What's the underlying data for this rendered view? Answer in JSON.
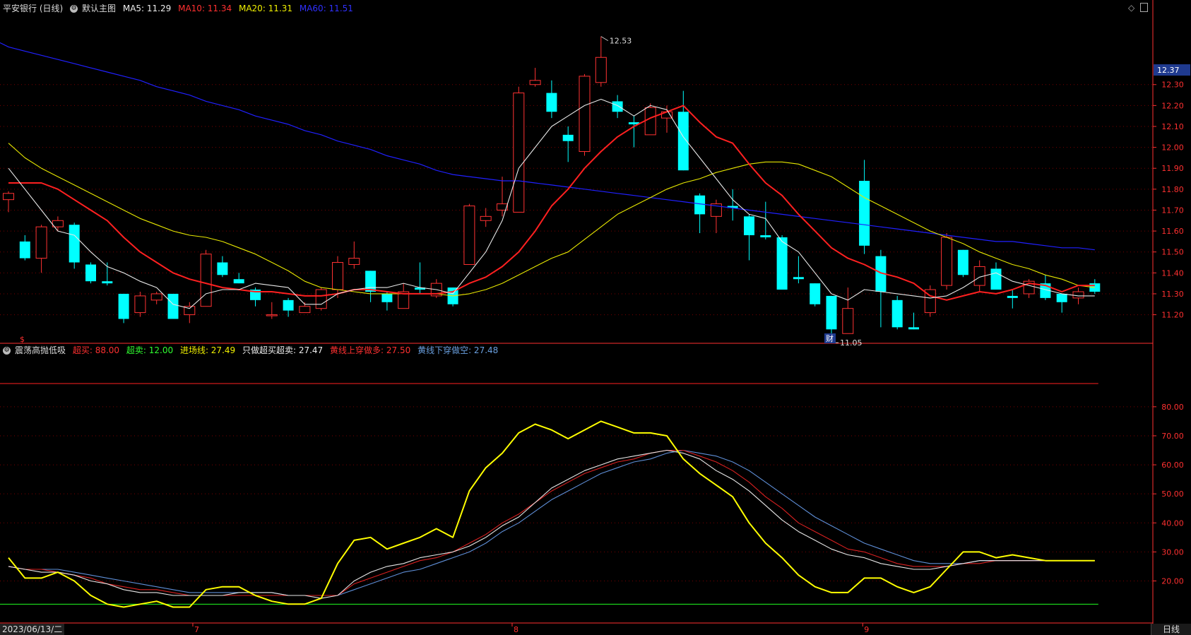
{
  "main_legend": {
    "title": "平安银行 (日线)",
    "template": "默认主图",
    "ma5": "MA5: 11.29",
    "ma10": "MA10: 11.34",
    "ma20": "MA20: 11.31",
    "ma60": "MA60: 11.51"
  },
  "sub_legend": {
    "title": "震荡高抛低吸",
    "overbuy": "超买: 88.00",
    "oversell": "超卖: 12.00",
    "entry": "进场线: 27.49",
    "only": "只做超买超卖: 27.47",
    "cross_up": "黄线上穿做多: 27.50",
    "cross_down": "黄线下穿做空: 27.48"
  },
  "colors": {
    "bg": "#000000",
    "up": "#ff3232",
    "down": "#00ffff",
    "ma5": "#e8e8e8",
    "ma10": "#ff2020",
    "ma20": "#e8e800",
    "ma60": "#2020ff",
    "grid": "#7a0000",
    "axis": "#ff3030",
    "entry": "#ffff00"
  },
  "price_marker": "12.37",
  "bottom_labels": {
    "date": "2023/06/13/二",
    "m7": "7",
    "m8": "8",
    "m9": "9",
    "tab": "日线"
  },
  "marks": {
    "s": "$",
    "cai": "财",
    "high": "12.53",
    "low": "11.05"
  },
  "chart_data": [
    {
      "type": "candlestick",
      "y_ticks": [
        "12.30",
        "12.20",
        "12.10",
        "12.00",
        "11.90",
        "11.80",
        "11.70",
        "11.60",
        "11.50",
        "11.40",
        "11.30",
        "11.20"
      ],
      "ylim": [
        11.05,
        12.63
      ],
      "candles": [
        [
          11.75,
          11.78,
          11.69,
          11.79
        ],
        [
          11.55,
          11.47,
          11.46,
          11.58
        ],
        [
          11.47,
          11.62,
          11.4,
          11.63
        ],
        [
          11.62,
          11.65,
          11.6,
          11.67
        ],
        [
          11.63,
          11.45,
          11.42,
          11.64
        ],
        [
          11.44,
          11.36,
          11.35,
          11.45
        ],
        [
          11.36,
          11.35,
          11.34,
          11.45
        ],
        [
          11.3,
          11.18,
          11.16,
          11.3
        ],
        [
          11.21,
          11.29,
          11.19,
          11.31
        ],
        [
          11.27,
          11.3,
          11.25,
          11.31
        ],
        [
          11.3,
          11.18,
          11.18,
          11.3
        ],
        [
          11.2,
          11.24,
          11.16,
          11.26
        ],
        [
          11.24,
          11.49,
          11.24,
          11.51
        ],
        [
          11.45,
          11.39,
          11.38,
          11.48
        ],
        [
          11.37,
          11.35,
          11.35,
          11.4
        ],
        [
          11.32,
          11.27,
          11.24,
          11.33
        ],
        [
          11.2,
          11.2,
          11.18,
          11.26
        ],
        [
          11.27,
          11.22,
          11.19,
          11.28
        ],
        [
          11.21,
          11.24,
          11.21,
          11.26
        ],
        [
          11.23,
          11.32,
          11.22,
          11.33
        ],
        [
          11.32,
          11.45,
          11.28,
          11.48
        ],
        [
          11.44,
          11.47,
          11.42,
          11.55
        ],
        [
          11.41,
          11.31,
          11.26,
          11.41
        ],
        [
          11.3,
          11.26,
          11.22,
          11.31
        ],
        [
          11.23,
          11.31,
          11.23,
          11.35
        ],
        [
          11.33,
          11.32,
          11.3,
          11.45
        ],
        [
          11.29,
          11.35,
          11.28,
          11.37
        ],
        [
          11.33,
          11.25,
          11.24,
          11.33
        ],
        [
          11.44,
          11.72,
          11.44,
          11.73
        ],
        [
          11.65,
          11.67,
          11.62,
          11.71
        ],
        [
          11.7,
          11.73,
          11.67,
          11.86
        ],
        [
          11.69,
          12.26,
          11.69,
          12.29
        ],
        [
          12.3,
          12.32,
          12.29,
          12.38
        ],
        [
          12.26,
          12.17,
          12.14,
          12.32
        ],
        [
          12.06,
          12.03,
          11.93,
          12.1
        ],
        [
          11.98,
          12.34,
          11.96,
          12.35
        ],
        [
          12.31,
          12.43,
          12.29,
          12.53
        ],
        [
          12.22,
          12.17,
          12.14,
          12.25
        ],
        [
          12.12,
          12.11,
          12.0,
          12.15
        ],
        [
          12.06,
          12.19,
          12.06,
          12.21
        ],
        [
          12.14,
          12.17,
          12.07,
          12.2
        ],
        [
          12.17,
          11.89,
          11.89,
          12.27
        ],
        [
          11.77,
          11.68,
          11.59,
          11.78
        ],
        [
          11.67,
          11.73,
          11.59,
          11.75
        ],
        [
          11.72,
          11.71,
          11.65,
          11.8
        ],
        [
          11.67,
          11.58,
          11.46,
          11.68
        ],
        [
          11.58,
          11.57,
          11.56,
          11.74
        ],
        [
          11.57,
          11.32,
          11.32,
          11.58
        ],
        [
          11.38,
          11.37,
          11.35,
          11.48
        ],
        [
          11.35,
          11.25,
          11.24,
          11.35
        ],
        [
          11.29,
          11.13,
          11.09,
          11.29
        ],
        [
          11.11,
          11.23,
          11.11,
          11.33
        ],
        [
          11.84,
          11.53,
          11.49,
          11.94
        ],
        [
          11.48,
          11.31,
          11.14,
          11.51
        ],
        [
          11.27,
          11.14,
          11.13,
          11.29
        ],
        [
          11.14,
          11.13,
          11.13,
          11.21
        ],
        [
          11.21,
          11.32,
          11.19,
          11.34
        ],
        [
          11.34,
          11.57,
          11.32,
          11.59
        ],
        [
          11.51,
          11.39,
          11.38,
          11.51
        ],
        [
          11.34,
          11.43,
          11.31,
          11.46
        ],
        [
          11.42,
          11.32,
          11.32,
          11.45
        ],
        [
          11.29,
          11.28,
          11.23,
          11.32
        ],
        [
          11.3,
          11.36,
          11.28,
          11.37
        ],
        [
          11.35,
          11.28,
          11.27,
          11.39
        ],
        [
          11.3,
          11.26,
          11.21,
          11.3
        ],
        [
          11.28,
          11.31,
          11.25,
          11.33
        ],
        [
          11.35,
          11.31,
          11.3,
          11.37
        ]
      ],
      "ma5": [
        11.9,
        11.8,
        11.7,
        11.6,
        11.58,
        11.5,
        11.43,
        11.4,
        11.36,
        11.33,
        11.25,
        11.23,
        11.3,
        11.32,
        11.32,
        11.35,
        11.34,
        11.33,
        11.25,
        11.25,
        11.3,
        11.32,
        11.33,
        11.33,
        11.35,
        11.33,
        11.32,
        11.3,
        11.4,
        11.5,
        11.65,
        11.9,
        12.0,
        12.1,
        12.15,
        12.2,
        12.23,
        12.2,
        12.15,
        12.2,
        12.18,
        12.05,
        11.95,
        11.85,
        11.75,
        11.68,
        11.66,
        11.55,
        11.5,
        11.4,
        11.3,
        11.27,
        11.32,
        11.31,
        11.3,
        11.29,
        11.28,
        11.29,
        11.33,
        11.38,
        11.4,
        11.36,
        11.34,
        11.32,
        11.3,
        11.29,
        11.29
      ],
      "ma10": [
        11.83,
        11.83,
        11.83,
        11.8,
        11.75,
        11.7,
        11.65,
        11.57,
        11.5,
        11.45,
        11.4,
        11.37,
        11.35,
        11.33,
        11.32,
        11.31,
        11.31,
        11.3,
        11.29,
        11.29,
        11.3,
        11.32,
        11.32,
        11.31,
        11.3,
        11.3,
        11.3,
        11.31,
        11.35,
        11.38,
        11.43,
        11.5,
        11.6,
        11.72,
        11.8,
        11.9,
        11.98,
        12.05,
        12.1,
        12.14,
        12.17,
        12.2,
        12.12,
        12.05,
        12.02,
        11.92,
        11.83,
        11.77,
        11.68,
        11.6,
        11.52,
        11.47,
        11.44,
        11.4,
        11.38,
        11.35,
        11.29,
        11.27,
        11.29,
        11.31,
        11.3,
        11.32,
        11.35,
        11.34,
        11.31,
        11.34,
        11.34
      ],
      "ma20": [
        12.02,
        11.95,
        11.9,
        11.86,
        11.82,
        11.78,
        11.74,
        11.7,
        11.66,
        11.63,
        11.6,
        11.58,
        11.57,
        11.55,
        11.52,
        11.49,
        11.45,
        11.41,
        11.36,
        11.33,
        11.32,
        11.31,
        11.3,
        11.3,
        11.3,
        11.3,
        11.3,
        11.29,
        11.3,
        11.32,
        11.35,
        11.39,
        11.43,
        11.47,
        11.5,
        11.56,
        11.62,
        11.68,
        11.72,
        11.76,
        11.8,
        11.83,
        11.85,
        11.88,
        11.9,
        11.92,
        11.93,
        11.93,
        11.92,
        11.89,
        11.86,
        11.81,
        11.76,
        11.72,
        11.68,
        11.64,
        11.6,
        11.57,
        11.54,
        11.5,
        11.47,
        11.44,
        11.42,
        11.39,
        11.37,
        11.34,
        11.33
      ],
      "ma60": [
        12.48,
        12.46,
        12.44,
        12.42,
        12.4,
        12.38,
        12.36,
        12.34,
        12.32,
        12.29,
        12.27,
        12.25,
        12.22,
        12.2,
        12.18,
        12.15,
        12.13,
        12.11,
        12.08,
        12.06,
        12.03,
        12.01,
        11.99,
        11.96,
        11.94,
        11.92,
        11.89,
        11.87,
        11.86,
        11.85,
        11.84,
        11.84,
        11.83,
        11.82,
        11.81,
        11.8,
        11.79,
        11.78,
        11.77,
        11.76,
        11.75,
        11.74,
        11.73,
        11.72,
        11.71,
        11.7,
        11.69,
        11.68,
        11.67,
        11.66,
        11.65,
        11.64,
        11.63,
        11.62,
        11.61,
        11.6,
        11.59,
        11.58,
        11.57,
        11.56,
        11.55,
        11.55,
        11.54,
        11.53,
        11.52,
        11.52,
        11.51
      ]
    },
    {
      "type": "line",
      "y_ticks": [
        "80.00",
        "70.00",
        "60.00",
        "50.00",
        "40.00",
        "30.00",
        "20.00"
      ],
      "ylim": [
        6,
        97
      ],
      "levels": {
        "overbuy": 88,
        "oversell": 12
      },
      "yellow": [
        28,
        21,
        21,
        23,
        20,
        15,
        12,
        11,
        12,
        13,
        11,
        11,
        17,
        18,
        18,
        15,
        13,
        12,
        12,
        14,
        26,
        34,
        35,
        31,
        33,
        35,
        38,
        35,
        51,
        59,
        64,
        71,
        74,
        72,
        69,
        72,
        75,
        73,
        71,
        71,
        70,
        62,
        57,
        53,
        49,
        40,
        33,
        28,
        22,
        18,
        16,
        16,
        21,
        21,
        18,
        16,
        18,
        24,
        30,
        30,
        28,
        29,
        28,
        27,
        27,
        27,
        27
      ],
      "white": [
        25,
        24,
        23,
        23,
        22,
        20,
        19,
        17,
        16,
        16,
        15,
        15,
        15,
        15,
        16,
        16,
        16,
        15,
        15,
        14,
        15,
        20,
        23,
        25,
        26,
        28,
        29,
        30,
        32,
        35,
        39,
        42,
        47,
        52,
        55,
        58,
        60,
        62,
        63,
        64,
        65,
        64,
        62,
        58,
        55,
        51,
        46,
        41,
        37,
        34,
        31,
        29,
        28,
        26,
        25,
        24,
        24,
        25,
        26,
        27,
        27,
        27,
        27,
        27,
        27,
        27,
        27
      ],
      "red": [
        25,
        24,
        24,
        23,
        22,
        21,
        19,
        18,
        17,
        17,
        16,
        15,
        15,
        15,
        15,
        15,
        15,
        15,
        15,
        15,
        15,
        19,
        21,
        23,
        25,
        27,
        28,
        30,
        33,
        36,
        40,
        43,
        47,
        51,
        54,
        57,
        59,
        61,
        62,
        64,
        65,
        65,
        63,
        61,
        58,
        54,
        49,
        45,
        40,
        37,
        34,
        31,
        30,
        28,
        26,
        25,
        25,
        25,
        26,
        26,
        27,
        27,
        27,
        27,
        27,
        27,
        27
      ],
      "blue": [
        25,
        24,
        24,
        24,
        23,
        22,
        21,
        20,
        19,
        18,
        17,
        16,
        16,
        16,
        16,
        16,
        16,
        15,
        15,
        15,
        15,
        17,
        19,
        21,
        23,
        24,
        26,
        28,
        30,
        33,
        37,
        40,
        44,
        48,
        51,
        54,
        57,
        59,
        61,
        62,
        64,
        65,
        64,
        63,
        61,
        58,
        54,
        50,
        46,
        42,
        39,
        36,
        33,
        31,
        29,
        27,
        26,
        26,
        26,
        27,
        27,
        27,
        27,
        27,
        27,
        27,
        27
      ]
    }
  ]
}
